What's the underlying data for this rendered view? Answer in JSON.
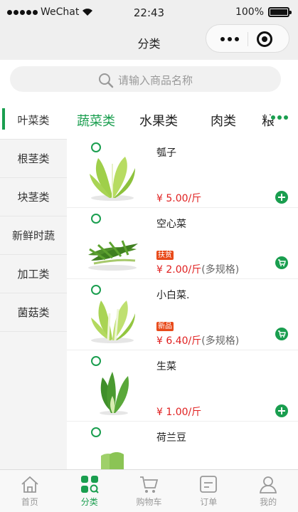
{
  "status_bar": {
    "carrier": "WeChat",
    "time": "22:43",
    "battery": "100%"
  },
  "nav": {
    "title": "分类"
  },
  "search": {
    "placeholder": "请输入商品名称"
  },
  "sidebar": {
    "items": [
      {
        "label": "叶菜类"
      },
      {
        "label": "根茎类"
      },
      {
        "label": "块茎类"
      },
      {
        "label": "新鲜时蔬"
      },
      {
        "label": "加工类"
      },
      {
        "label": "菌菇类"
      }
    ]
  },
  "tabs": [
    {
      "label": "蔬菜类"
    },
    {
      "label": "水果类"
    },
    {
      "label": "肉类"
    },
    {
      "label": "粮"
    }
  ],
  "products": [
    {
      "name": "瓠子",
      "tag": "",
      "price": "¥ 5.00/斤",
      "extra": ""
    },
    {
      "name": "空心菜",
      "tag": "扶贫",
      "price": "¥ 2.00/斤",
      "extra": "(多规格)"
    },
    {
      "name": "小白菜.",
      "tag": "新品",
      "price": "¥ 6.40/斤",
      "extra": "(多规格)"
    },
    {
      "name": "生菜",
      "tag": "",
      "price": "¥ 1.00/斤",
      "extra": ""
    },
    {
      "name": "荷兰豆",
      "tag": "",
      "price": "",
      "extra": ""
    }
  ],
  "tabbar": [
    {
      "label": "首页",
      "icon": "home-icon"
    },
    {
      "label": "分类",
      "icon": "category-icon"
    },
    {
      "label": "购物车",
      "icon": "cart-icon"
    },
    {
      "label": "订单",
      "icon": "order-icon"
    },
    {
      "label": "我的",
      "icon": "user-icon"
    }
  ],
  "colors": {
    "accent": "#1a9e4f",
    "price": "#e01f1f",
    "tag": "#e84a1a"
  }
}
